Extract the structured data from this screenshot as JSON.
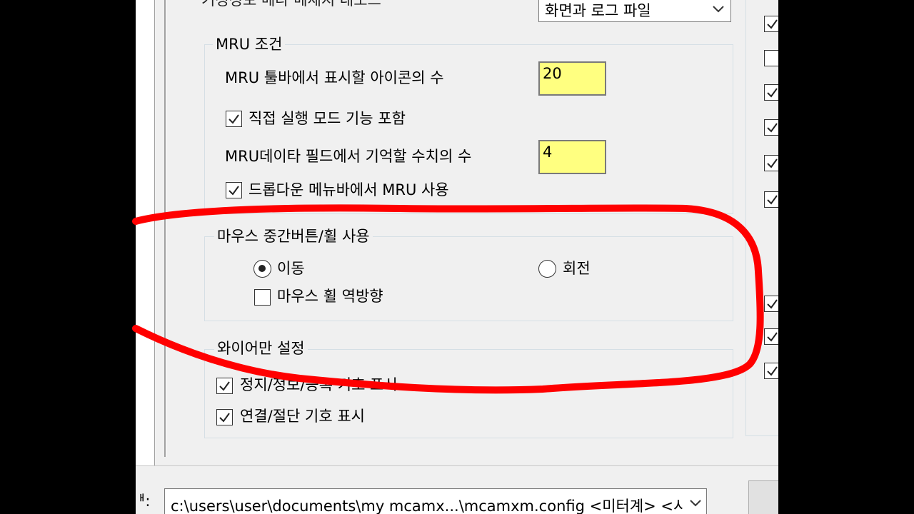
{
  "top": {
    "partial_label": "기정정보 메타 메세지 대모드",
    "output_select": "화면과 로그 파일"
  },
  "mru": {
    "group_title": "MRU 조건",
    "toolbar_icons_label": "MRU 툴바에서 표시할 아이콘의 수",
    "toolbar_icons_value": "20",
    "direct_mode_label": "직접 실행 모드 기능 포함",
    "direct_mode_checked": true,
    "data_field_label": "MRU데이타 필드에서 기억할 수치의 수",
    "data_field_value": "4",
    "dropdown_mru_label": "드롭다운 메뉴바에서  MRU 사용",
    "dropdown_mru_checked": true
  },
  "mouse": {
    "group_title": "마우스 중간버튼/휠 사용",
    "pan_label": "이동",
    "pan_selected": true,
    "rotate_label": "회전",
    "rotate_selected": false,
    "reverse_wheel_label": "마우스 휠 역방향",
    "reverse_wheel_checked": false
  },
  "wireframe": {
    "group_title": "와이어만 설정",
    "stop_symbol_label": "정지/정보/등록 기호 표시",
    "stop_symbol_checked": true,
    "connect_symbol_label": "연결/절단 기호 표시",
    "connect_symbol_checked": true
  },
  "footer": {
    "path_label": "ᅢ:",
    "config_path": "c:\\users\\user\\documents\\my mcamx...\\mcamxm.config <미터계> <시작"
  },
  "right_column": {
    "checks": [
      true,
      false,
      true,
      true,
      true,
      true,
      true,
      true,
      true
    ]
  },
  "colors": {
    "window_bg": "#f0f0f0",
    "numeric_field_bg": "#ffff80",
    "annotation_red": "#ff0000"
  }
}
